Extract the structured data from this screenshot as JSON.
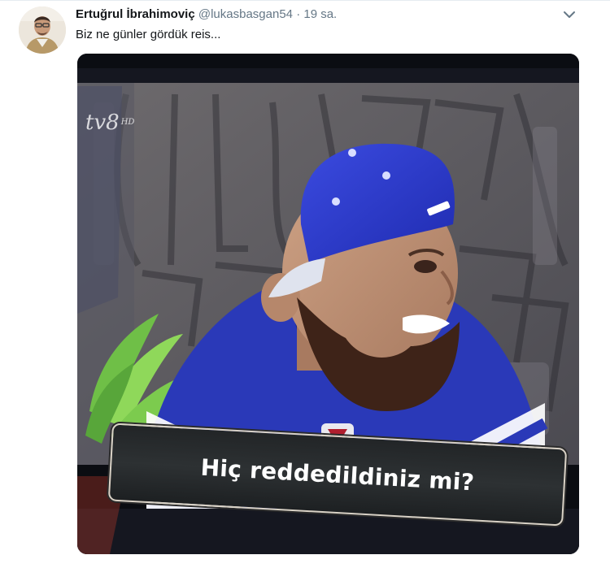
{
  "tweet": {
    "display_name": "Ertuğrul İbrahimoviç",
    "handle": "@lukasbasgan54",
    "separator": "·",
    "timestamp": "19 sa.",
    "text": "Biz ne günler gördük reis...",
    "menu_icon": "chevron-down-icon"
  },
  "media": {
    "channel_logo_main": "tv8",
    "channel_logo_suffix": "HD",
    "caption": "Hiç reddedildiniz mi?"
  },
  "colors": {
    "name": "#14171a",
    "secondary_text": "#657786",
    "cap_blue": "#2f3fd0",
    "jersey_blue": "#2a39b8"
  }
}
